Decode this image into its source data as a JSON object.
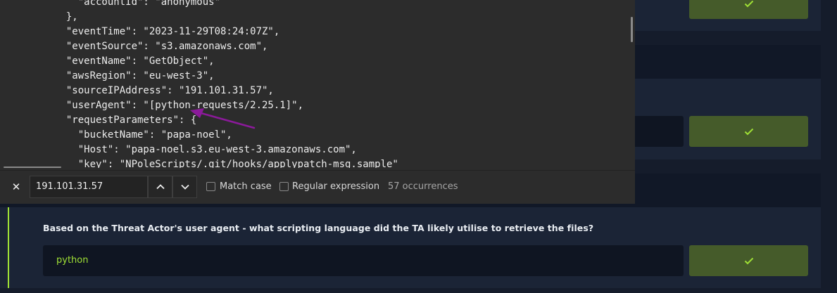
{
  "code_lines": [
    "    \"accountId\": \"anonymous\"",
    "  },",
    "  \"eventTime\": \"2023-11-29T08:24:07Z\",",
    "  \"eventSource\": \"s3.amazonaws.com\",",
    "  \"eventName\": \"GetObject\",",
    "  \"awsRegion\": \"eu-west-3\",",
    "  \"sourceIPAddress\": \"191.101.31.57\",",
    "  \"userAgent\": \"[python-requests/2.25.1]\",",
    "  \"requestParameters\": {",
    "    \"bucketName\": \"papa-noel\",",
    "    \"Host\": \"papa-noel.s3.eu-west-3.amazonaws.com\",",
    "    \"key\": \"NPoleScripts/.git/hooks/applypatch-msg.sample\""
  ],
  "find": {
    "query": "191.101.31.57",
    "match_case_label": "Match case",
    "regex_label": "Regular expression",
    "occurrences": "57 occurrences",
    "close_icon": "close-icon",
    "prev_icon": "chevron-up-icon",
    "next_icon": "chevron-down-icon"
  },
  "question": {
    "text": "Based on the Threat Actor's user agent - what scripting language did the TA likely utilise to retrieve the files?",
    "answer": "python"
  },
  "colors": {
    "accent": "#9fe035",
    "annotation_arrow": "#8b1a9a",
    "submit_bg": "#455b2a"
  }
}
